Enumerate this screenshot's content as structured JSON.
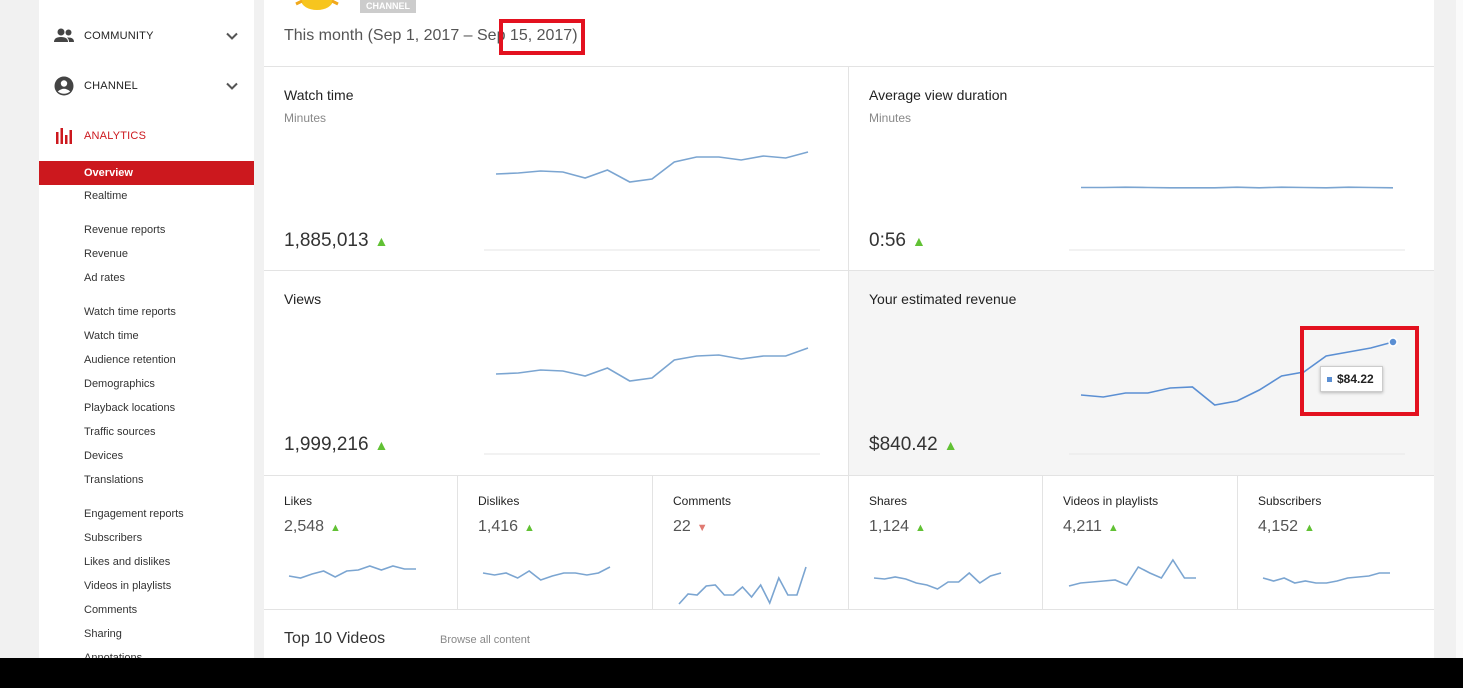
{
  "sidebar": {
    "sections": [
      {
        "label": "COMMUNITY",
        "icon": "people-icon"
      },
      {
        "label": "CHANNEL",
        "icon": "account-circle-icon"
      },
      {
        "label": "ANALYTICS",
        "icon": "bar-chart-icon"
      }
    ],
    "items": [
      {
        "label": "Overview"
      },
      {
        "label": "Realtime"
      },
      {
        "label": "Revenue reports"
      },
      {
        "label": "Revenue"
      },
      {
        "label": "Ad rates"
      },
      {
        "label": "Watch time reports"
      },
      {
        "label": "Watch time"
      },
      {
        "label": "Audience retention"
      },
      {
        "label": "Demographics"
      },
      {
        "label": "Playback locations"
      },
      {
        "label": "Traffic sources"
      },
      {
        "label": "Devices"
      },
      {
        "label": "Translations"
      },
      {
        "label": "Engagement reports"
      },
      {
        "label": "Subscribers"
      },
      {
        "label": "Likes and dislikes"
      },
      {
        "label": "Videos in playlists"
      },
      {
        "label": "Comments"
      },
      {
        "label": "Sharing"
      },
      {
        "label": "Annotations"
      }
    ]
  },
  "header": {
    "badge": "CHANNEL",
    "date_range": "This month (Sep 1, 2017 – Sep 15, 2017)"
  },
  "metrics": {
    "watch_time": {
      "title": "Watch time",
      "unit": "Minutes",
      "value": "1,885,013"
    },
    "avg_view_duration": {
      "title": "Average view duration",
      "unit": "Minutes",
      "value": "0:56"
    },
    "views": {
      "title": "Views",
      "value": "1,999,216"
    },
    "revenue": {
      "title": "Your estimated revenue",
      "value": "$840.42",
      "tooltip": "$84.22"
    }
  },
  "small_metrics": [
    {
      "title": "Likes",
      "value": "2,548",
      "trend": "up"
    },
    {
      "title": "Dislikes",
      "value": "1,416",
      "trend": "up"
    },
    {
      "title": "Comments",
      "value": "22",
      "trend": "down"
    },
    {
      "title": "Shares",
      "value": "1,124",
      "trend": "up"
    },
    {
      "title": "Videos in playlists",
      "value": "4,211",
      "trend": "up"
    },
    {
      "title": "Subscribers",
      "value": "4,152",
      "trend": "up"
    }
  ],
  "trend_symbols": {
    "up": "▲",
    "down": "▼"
  },
  "footer": {
    "top10": "Top 10 Videos",
    "browse": "Browse all content"
  },
  "colors": {
    "accent": "#cc181e",
    "highlight": "#e3111f",
    "line": "#7ba5d1",
    "up": "#61c134",
    "down": "#e07a72"
  },
  "sparklines": {
    "watch_time": [
      174,
      173,
      171,
      172,
      178,
      170,
      182,
      179,
      162,
      157,
      157,
      160,
      156,
      158,
      152
    ],
    "avg_view_duration": [
      187.5,
      187.5,
      187.2,
      187.5,
      187.8,
      187.8,
      187.8,
      187.2,
      187.8,
      187.2,
      187.5,
      187.8,
      187.2,
      187.5,
      187.8
    ],
    "views": [
      374,
      373,
      370,
      371,
      376,
      368,
      381,
      378,
      360,
      356,
      355,
      359,
      356,
      356,
      348
    ],
    "revenue": [
      395,
      397,
      393,
      393,
      388,
      387,
      405,
      401,
      390,
      376,
      372,
      356,
      352,
      348,
      342
    ],
    "likes": [
      576,
      578,
      574,
      571,
      577,
      571,
      570,
      566,
      570,
      566,
      569,
      569
    ],
    "dislikes": [
      573,
      575,
      573,
      578,
      571,
      580,
      576,
      573,
      573,
      575,
      573,
      567
    ],
    "comments": [
      604,
      594,
      595,
      586,
      585,
      595,
      595,
      587,
      597,
      585,
      603,
      578,
      595,
      595,
      567
    ],
    "shares": [
      578,
      579,
      577,
      579,
      583,
      585,
      589,
      582,
      582,
      573,
      583,
      576,
      573
    ],
    "playlists": [
      586,
      583,
      582,
      581,
      580,
      585,
      567,
      573,
      578,
      560,
      578,
      578
    ],
    "subscribers": [
      578,
      581,
      578,
      583,
      581,
      583,
      583,
      581,
      578,
      577,
      576,
      573,
      573
    ]
  }
}
